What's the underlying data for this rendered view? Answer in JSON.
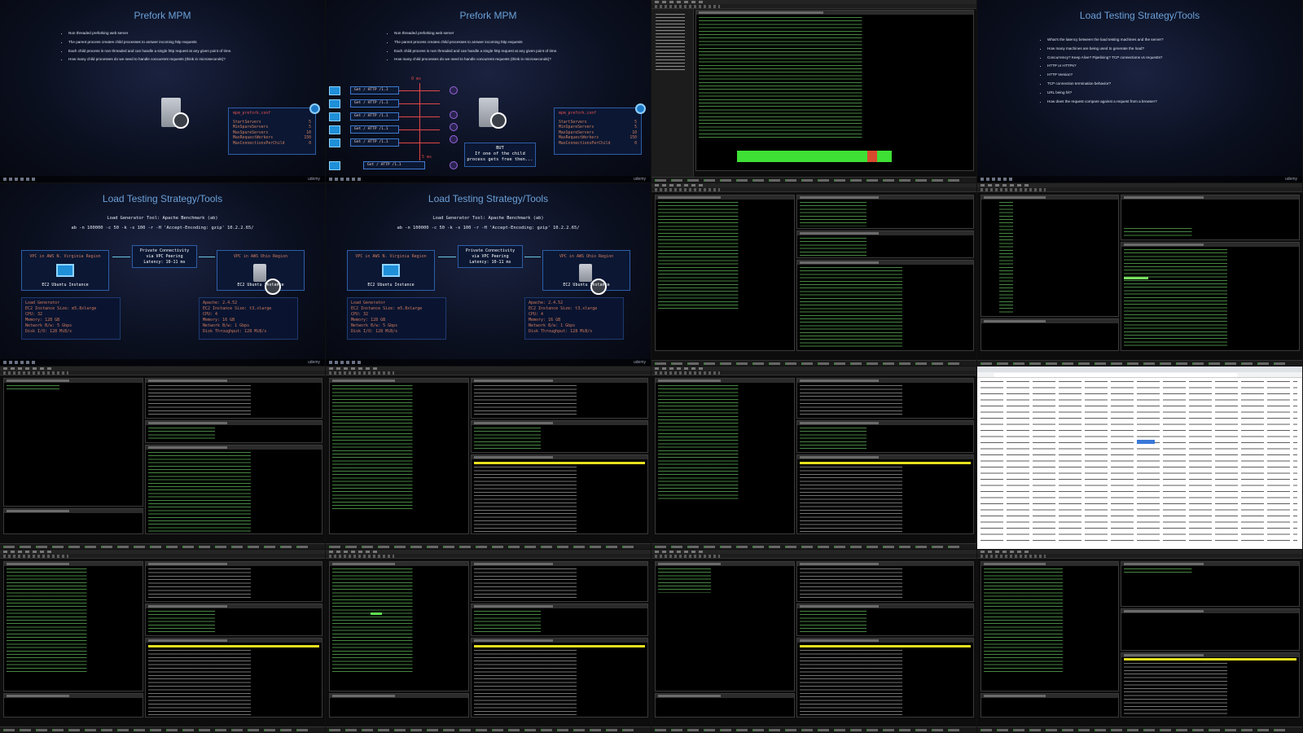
{
  "slides": {
    "prefork_title": "Prefork MPM",
    "prefork_bullets": [
      "Non threaded preforking web server",
      "The parent process creates child processes to answer incoming http requests",
      "Each child process is non threaded and can handle a single http request at any given point of time.",
      "How many child processes do we need to handle concurrent requests (think in microseconds)?"
    ],
    "conf": {
      "file": "mpm_prefork.conf",
      "rows": [
        {
          "key": "StartServers",
          "value": "5"
        },
        {
          "key": "MinSpareServers",
          "value": "5"
        },
        {
          "key": "MaxSpareServers",
          "value": "10"
        },
        {
          "key": "MaxRequestWorkers",
          "value": "150"
        },
        {
          "key": "MaxConnectionsPerChild",
          "value": "0"
        }
      ]
    },
    "requests": [
      "Get / HTTP /1.1",
      "Get / HTTP /1.1",
      "Get / HTTP /1.1",
      "Get / HTTP /1.1",
      "Get / HTTP /1.1",
      "Get / HTTP /1.1"
    ],
    "ms_start": "0 ms",
    "ms_end": "5 ms",
    "but": {
      "title": "BUT",
      "line1": "If one of the child",
      "line2": "process gets free then..."
    },
    "load_title": "Load Testing Strategy/Tools",
    "load_bullets": [
      "What's the latency between the load testing machines and the server?",
      "How many machines are being used to generate the load?",
      "Concurrency? Keep Alive? Pipelining? TCP connections vs requests?",
      "HTTP or HTTPs?",
      "HTTP Version?",
      "TCP connection termination behavior?",
      "URL being hit?",
      "How does the request compare against a request from a browser?"
    ],
    "lg_tool": "Load Generator Tool: Apache Benchmark (ab)",
    "lg_cmd": "ab -n 100000 -c 50 -k -s 100 -r -H 'Accept-Encoding: gzip' 10.2.2.65/",
    "vpc_left": "VPC in AWS N. Virginia Region",
    "vpc_right": "VPC in AWS Ohio Region",
    "ec2": "EC2 Ubuntu Instance",
    "peer": {
      "l1": "Private Connectivity",
      "l2": "via VPC Peering",
      "l3": "Latency: 10-11 ms"
    },
    "spec_left": [
      "Load Generator",
      "",
      "EC2 Instance Size: m5.8xlarge",
      "CPU: 32",
      "Memory: 128 GB",
      "Network B/w: 5 Gbps",
      "Disk I/O: 128 MiB/s"
    ],
    "spec_right": [
      "Apache: 2.4.52",
      "",
      "EC2 Instance Size: t3.xlarge",
      "CPU: 4",
      "Memory: 16 GB",
      "Network B/w: 1 Gbps",
      "Disk Throughput: 128 MiB/s"
    ],
    "brand": "udemy"
  },
  "colors": {
    "slide_bg": "#0b1020",
    "title": "#6aa0d8",
    "terminal_green": "#76e06e",
    "highlight_yellow": "#e8e020"
  }
}
